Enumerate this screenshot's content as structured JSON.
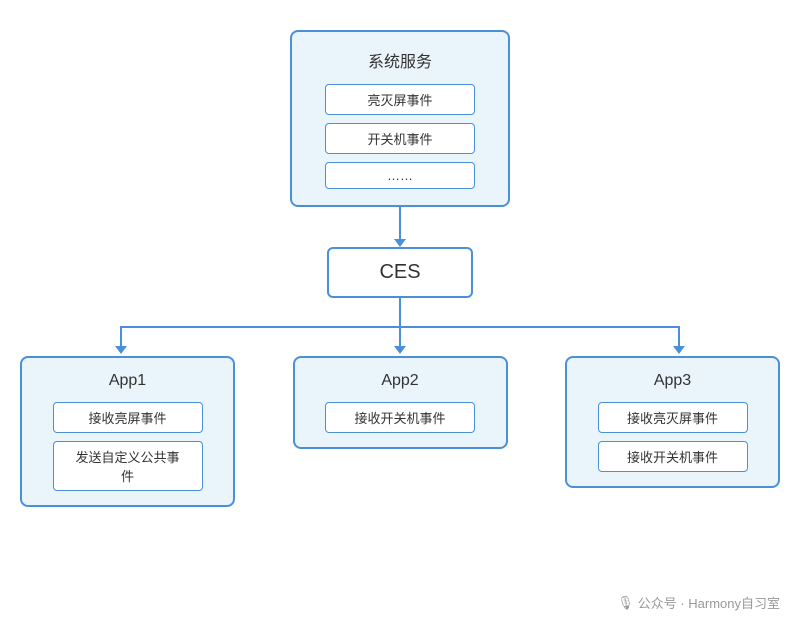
{
  "background": "#ffffff",
  "accent_color": "#4a90d9",
  "diagram": {
    "system_service": {
      "title": "系统服务",
      "events": [
        "亮灭屏事件",
        "开关机事件",
        "……"
      ]
    },
    "ces": {
      "label": "CES"
    },
    "apps": [
      {
        "title": "App1",
        "events": [
          "接收亮屏事件",
          "发送自定义公共事件"
        ]
      },
      {
        "title": "App2",
        "events": [
          "接收开关机事件"
        ]
      },
      {
        "title": "App3",
        "events": [
          "接收亮灭屏事件",
          "接收开关机事件"
        ]
      }
    ]
  },
  "watermark": {
    "icon": "🎙",
    "text": "公众号 · Harmony自习室"
  }
}
